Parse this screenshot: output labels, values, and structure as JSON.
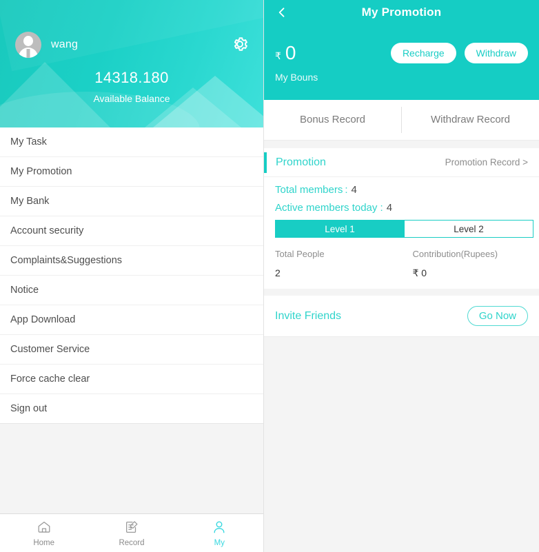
{
  "colors": {
    "teal": "#15cdc4",
    "teal_light": "#2fd4cb",
    "tab_active": "#38d8e0",
    "page_bg": "#f4f4f4",
    "text_dark": "#4e4e4e",
    "text_muted": "#8d8d8d"
  },
  "left": {
    "profile": {
      "username": "wang",
      "balance_amount": "14318.180",
      "balance_label": "Available Balance",
      "avatar_icon": "user-avatar-icon",
      "settings_icon": "gear-icon"
    },
    "menu": [
      {
        "label": "My Task"
      },
      {
        "label": "My Promotion"
      },
      {
        "label": "My Bank"
      },
      {
        "label": "Account security"
      },
      {
        "label": "Complaints&Suggestions"
      },
      {
        "label": "Notice"
      },
      {
        "label": "App Download"
      },
      {
        "label": "Customer Service"
      },
      {
        "label": "Force cache clear"
      },
      {
        "label": "Sign out"
      }
    ],
    "tabbar": [
      {
        "label": "Home",
        "icon": "home-icon",
        "active": false
      },
      {
        "label": "Record",
        "icon": "document-edit-icon",
        "active": false
      },
      {
        "label": "My",
        "icon": "person-icon",
        "active": true
      }
    ]
  },
  "right": {
    "header": {
      "back_icon": "chevron-left-icon",
      "title": "My Promotion",
      "rupee_symbol": "₹",
      "bonus_value": "0",
      "bonus_label": "My Bouns",
      "recharge_label": "Recharge",
      "withdraw_label": "Withdraw"
    },
    "record_tabs": [
      {
        "label": "Bonus Record"
      },
      {
        "label": "Withdraw Record"
      }
    ],
    "promotion": {
      "section_label": "Promotion",
      "record_link": "Promotion Record >",
      "total_members_label": "Total members :",
      "total_members_value": "4",
      "active_members_label": "Active members today :",
      "active_members_value": "4",
      "levels": [
        {
          "label": "Level 1",
          "active": true
        },
        {
          "label": "Level 2",
          "active": false
        }
      ],
      "stats": {
        "headers": [
          "Total People",
          "Contribution(Rupees)"
        ],
        "row": [
          "2",
          "₹ 0"
        ]
      }
    },
    "invite": {
      "label": "Invite Friends",
      "button_label": "Go Now"
    }
  }
}
